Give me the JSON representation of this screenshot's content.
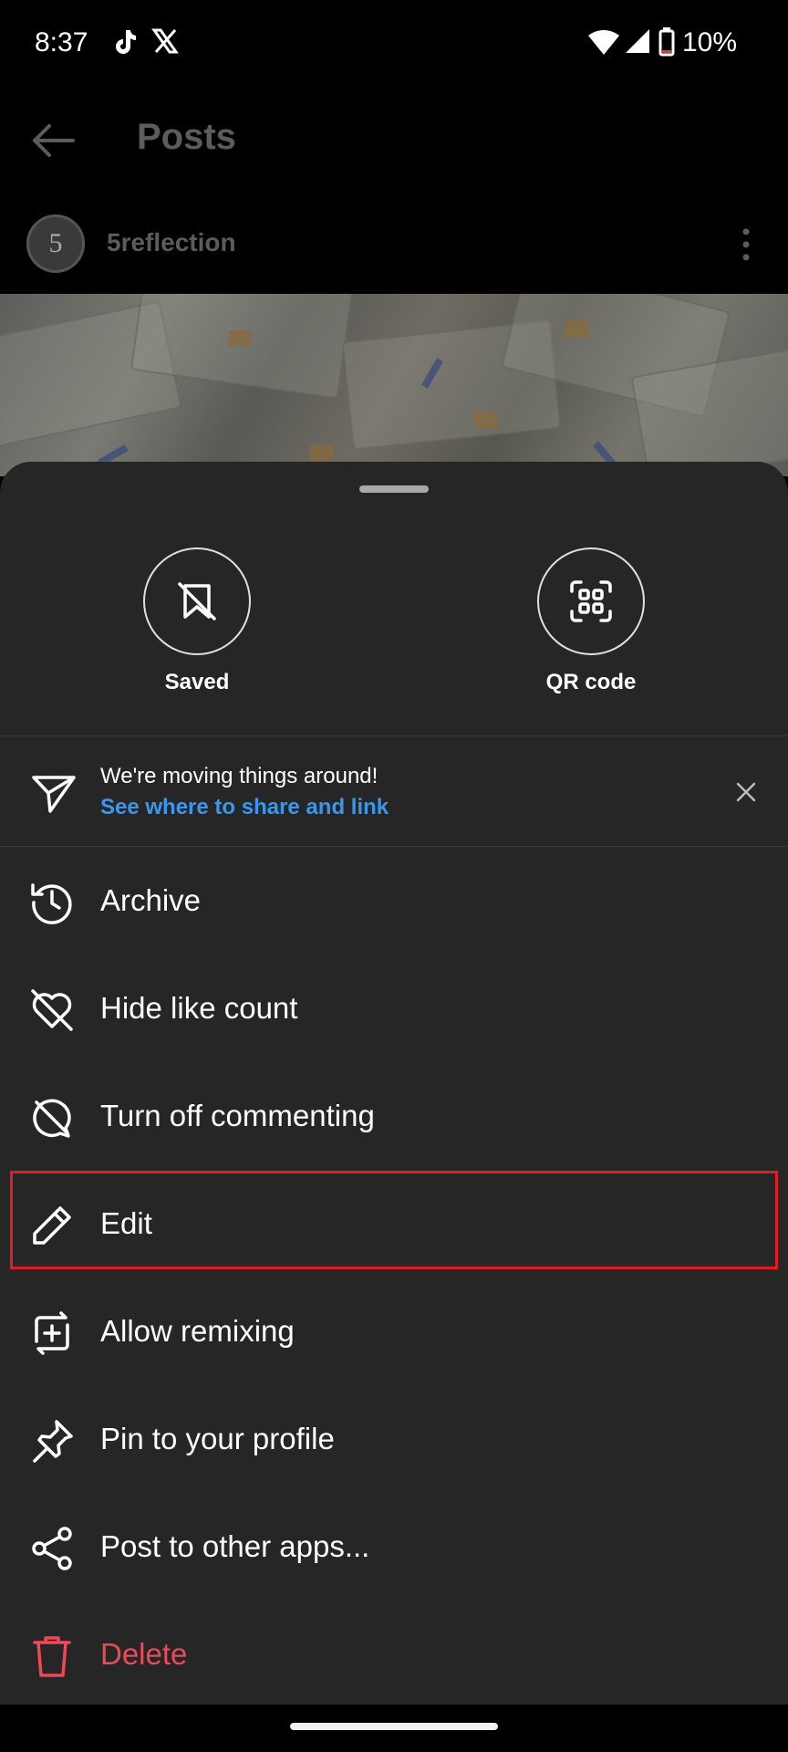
{
  "status_bar": {
    "time": "8:37",
    "battery_percent": "10%",
    "notification_icons": [
      "tiktok-icon",
      "x-icon"
    ],
    "system_icons": [
      "wifi-icon",
      "signal-icon",
      "battery-icon"
    ]
  },
  "header": {
    "title": "Posts",
    "back_icon": "arrow-left-icon"
  },
  "post": {
    "username": "5reflection",
    "avatar_text": "5",
    "more_icon": "more-vertical-icon"
  },
  "sheet": {
    "quick_actions": [
      {
        "label": "Saved",
        "icon": "bookmark-off-icon"
      },
      {
        "label": "QR code",
        "icon": "qr-code-icon"
      }
    ],
    "notice": {
      "title": "We're moving things around!",
      "link": "See where to share and link",
      "icon": "send-icon",
      "close_icon": "close-icon"
    },
    "items": [
      {
        "label": "Archive",
        "icon": "archive-clock-icon"
      },
      {
        "label": "Hide like count",
        "icon": "heart-off-icon"
      },
      {
        "label": "Turn off commenting",
        "icon": "comment-off-icon"
      },
      {
        "label": "Edit",
        "icon": "pencil-icon"
      },
      {
        "label": "Allow remixing",
        "icon": "remix-icon"
      },
      {
        "label": "Pin to your profile",
        "icon": "pin-icon"
      },
      {
        "label": "Post to other apps...",
        "icon": "share-icon"
      },
      {
        "label": "Delete",
        "icon": "trash-icon"
      }
    ]
  },
  "colors": {
    "sheet_bg": "#262626",
    "link_blue": "#3897f0",
    "danger_red": "#ed4956",
    "highlight_red": "#e31b23"
  }
}
